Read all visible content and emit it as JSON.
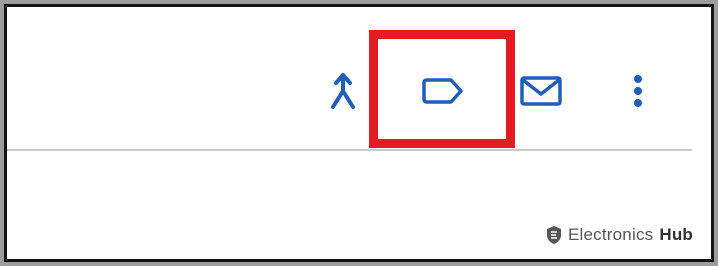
{
  "toolbar": {
    "icons": {
      "merge": "call-merge-icon",
      "label": "label-tag-icon",
      "mail": "mail-envelope-icon",
      "more": "more-vertical-icon"
    },
    "icon_color": "#1f5fb8"
  },
  "annotation": {
    "highlight_color": "#e31b23"
  },
  "watermark": {
    "brand": "Electronics",
    "suffix": "Hub"
  }
}
